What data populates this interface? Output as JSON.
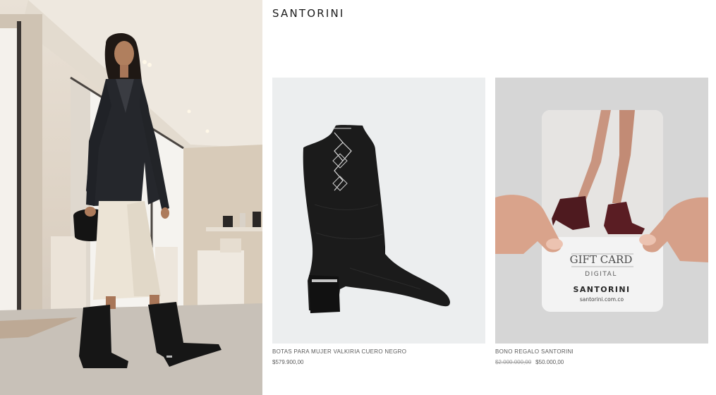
{
  "brand": {
    "name": "SANTORINI"
  },
  "hero": {
    "alt_subject": "model-walking-in-boots"
  },
  "products": [
    {
      "name": "BOTAS PARA MUJER VALKIRIA CUERO NEGRO",
      "price": "$579.900,00",
      "icon": "boot-image"
    },
    {
      "name": "BONO REGALO SANTORINI",
      "old_price": "$2.000.000,00",
      "price": "$50.000,00",
      "icon": "gift-card-image",
      "card": {
        "title": "GIFT CARD",
        "subtitle": "DIGITAL",
        "brand": "SANTORINI",
        "url": "santorini.com.co"
      }
    }
  ],
  "colors": {
    "background": "#ffffff",
    "text": "#5a5a5a",
    "boot": "#1b1b1b",
    "product_bg": "#eceeef"
  }
}
